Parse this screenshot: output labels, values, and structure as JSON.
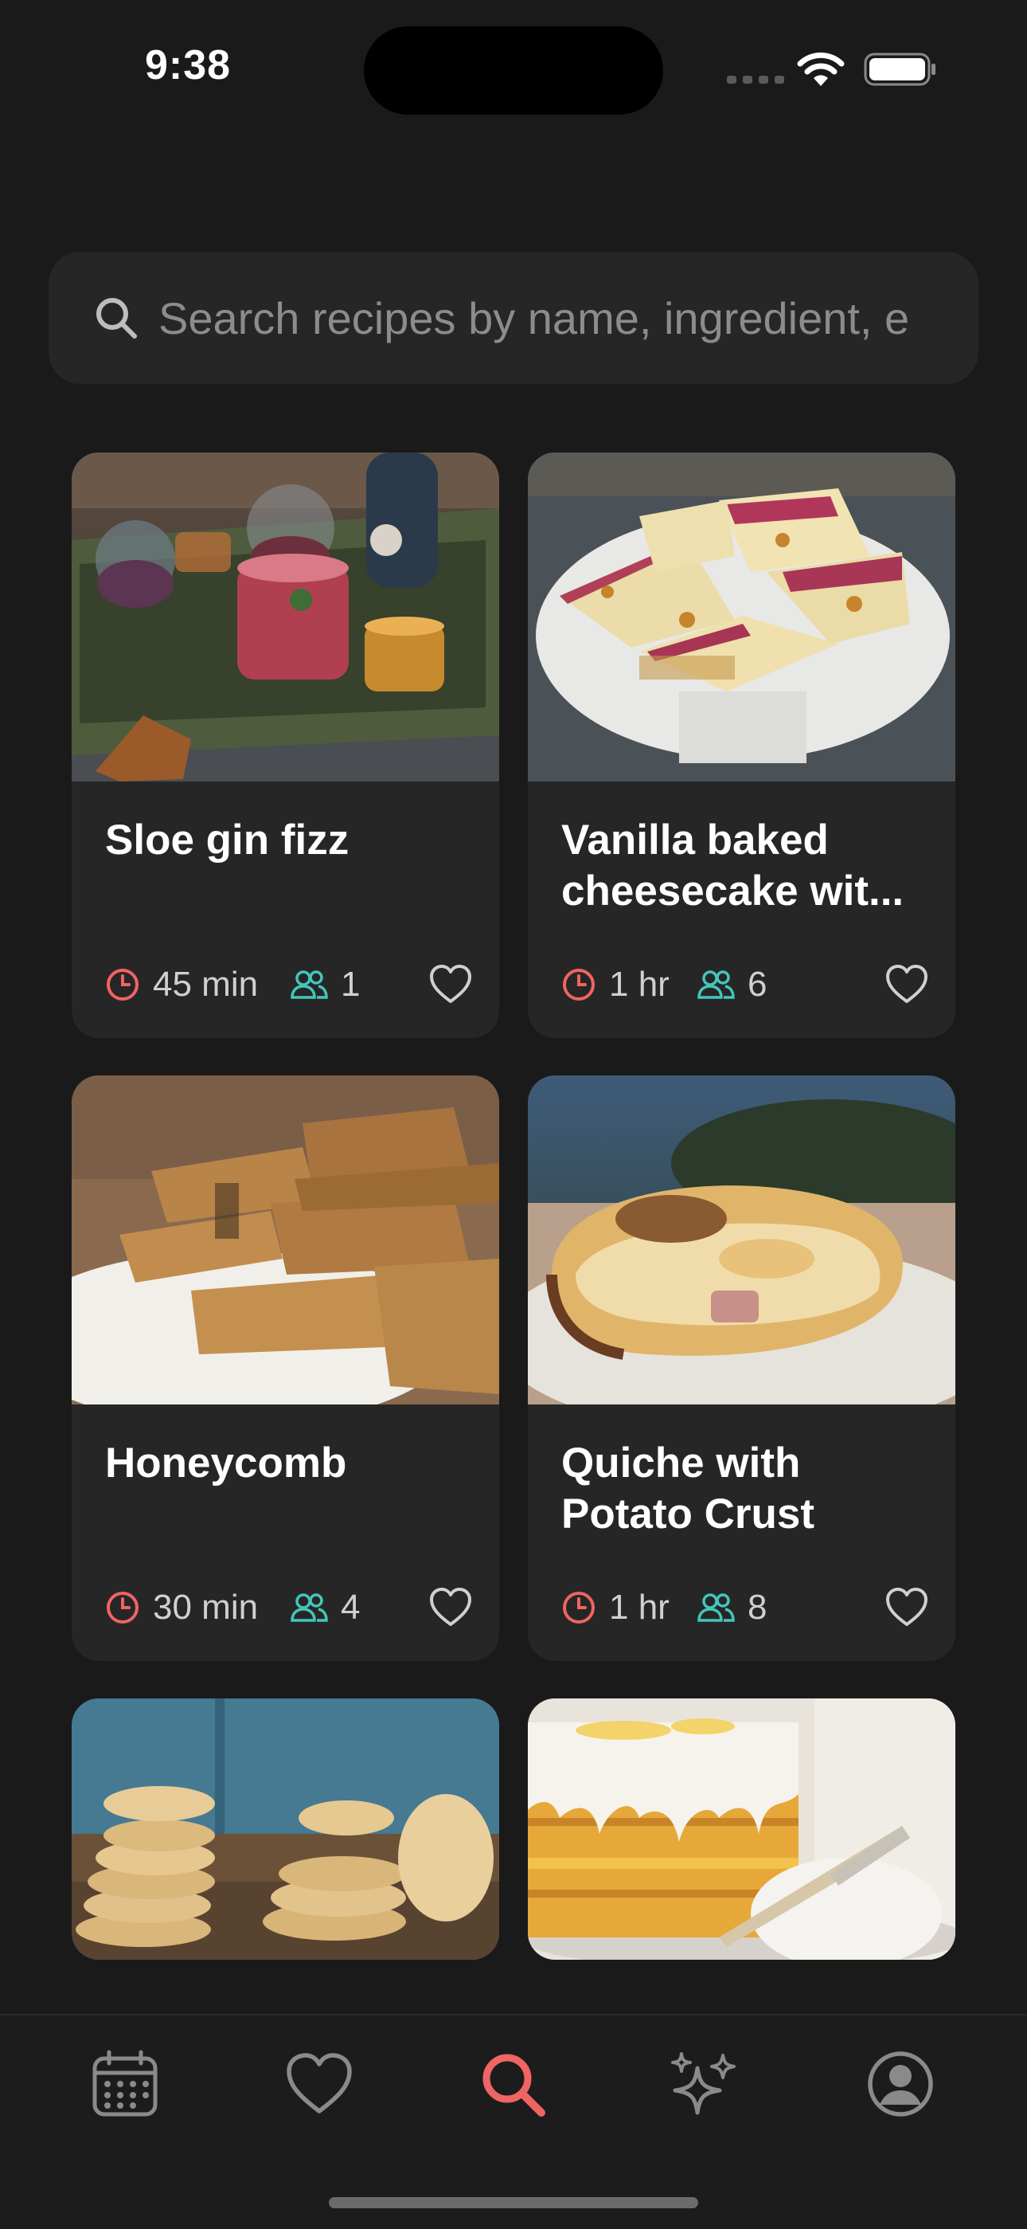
{
  "status": {
    "time": "9:38"
  },
  "search": {
    "placeholder": "Search recipes by name, ingredient, e"
  },
  "colors": {
    "accent": "#f06464",
    "teal": "#43c6bb",
    "background": "#1a1a1a",
    "card": "#262626"
  },
  "recipes": [
    {
      "title": "Sloe gin fizz",
      "time": "45 min",
      "servings": "1",
      "image": "drinks-on-wooden-tray"
    },
    {
      "title": "Vanilla baked cheesecake wit...",
      "time": "1 hr",
      "servings": "6",
      "image": "cheesecake-slices-on-stand"
    },
    {
      "title": "Honeycomb",
      "time": "30 min",
      "servings": "4",
      "image": "honeycomb-toffee-stack"
    },
    {
      "title": "Quiche with Potato Crust",
      "time": "1 hr",
      "servings": "8",
      "image": "quiche-slice-on-plate"
    },
    {
      "title": "",
      "time": "",
      "servings": "",
      "image": "stacked-flatbreads"
    },
    {
      "title": "",
      "time": "",
      "servings": "",
      "image": "lemon-drizzle-cake"
    }
  ],
  "tabs": [
    {
      "name": "calendar",
      "icon": "calendar-icon",
      "active": false
    },
    {
      "name": "favorites",
      "icon": "heart-icon",
      "active": false
    },
    {
      "name": "search",
      "icon": "search-icon",
      "active": true
    },
    {
      "name": "ai",
      "icon": "sparkles-icon",
      "active": false
    },
    {
      "name": "profile",
      "icon": "profile-icon",
      "active": false
    }
  ]
}
